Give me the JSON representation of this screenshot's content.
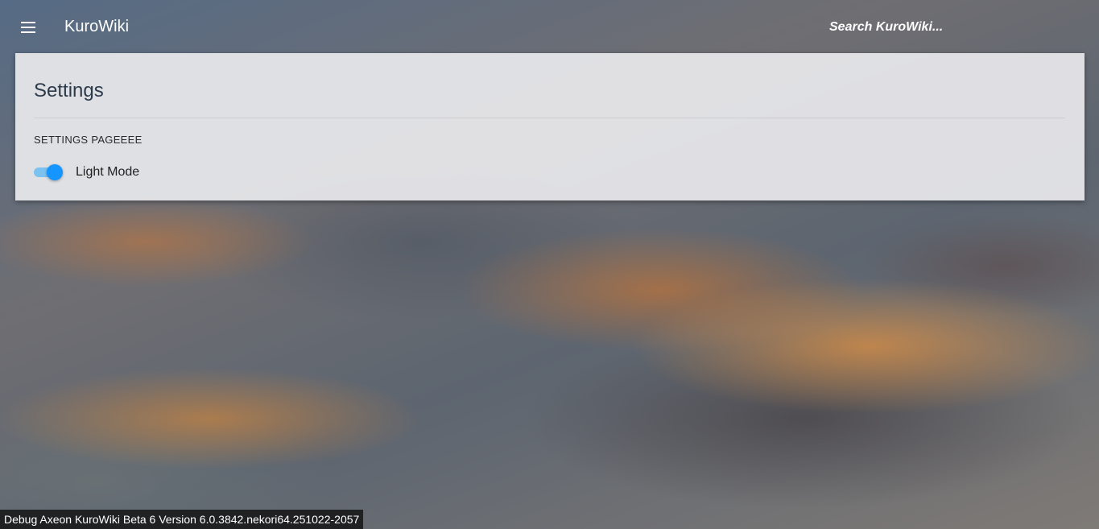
{
  "header": {
    "menu_icon": "hamburger-menu-icon",
    "title": "KuroWiki",
    "search": {
      "placeholder": "Search KuroWiki...",
      "value": ""
    }
  },
  "settings": {
    "title": "Settings",
    "section_label": "SETTINGS PAGEEEE",
    "light_mode": {
      "label": "Light Mode",
      "enabled": true
    }
  },
  "footer": {
    "debug_text": "Debug Axeon KuroWiki Beta 6 Version 6.0.3842.nekori64.251022-2057"
  },
  "colors": {
    "toggle_accent": "#1595ff",
    "toggle_track": "#7bc2f0"
  }
}
